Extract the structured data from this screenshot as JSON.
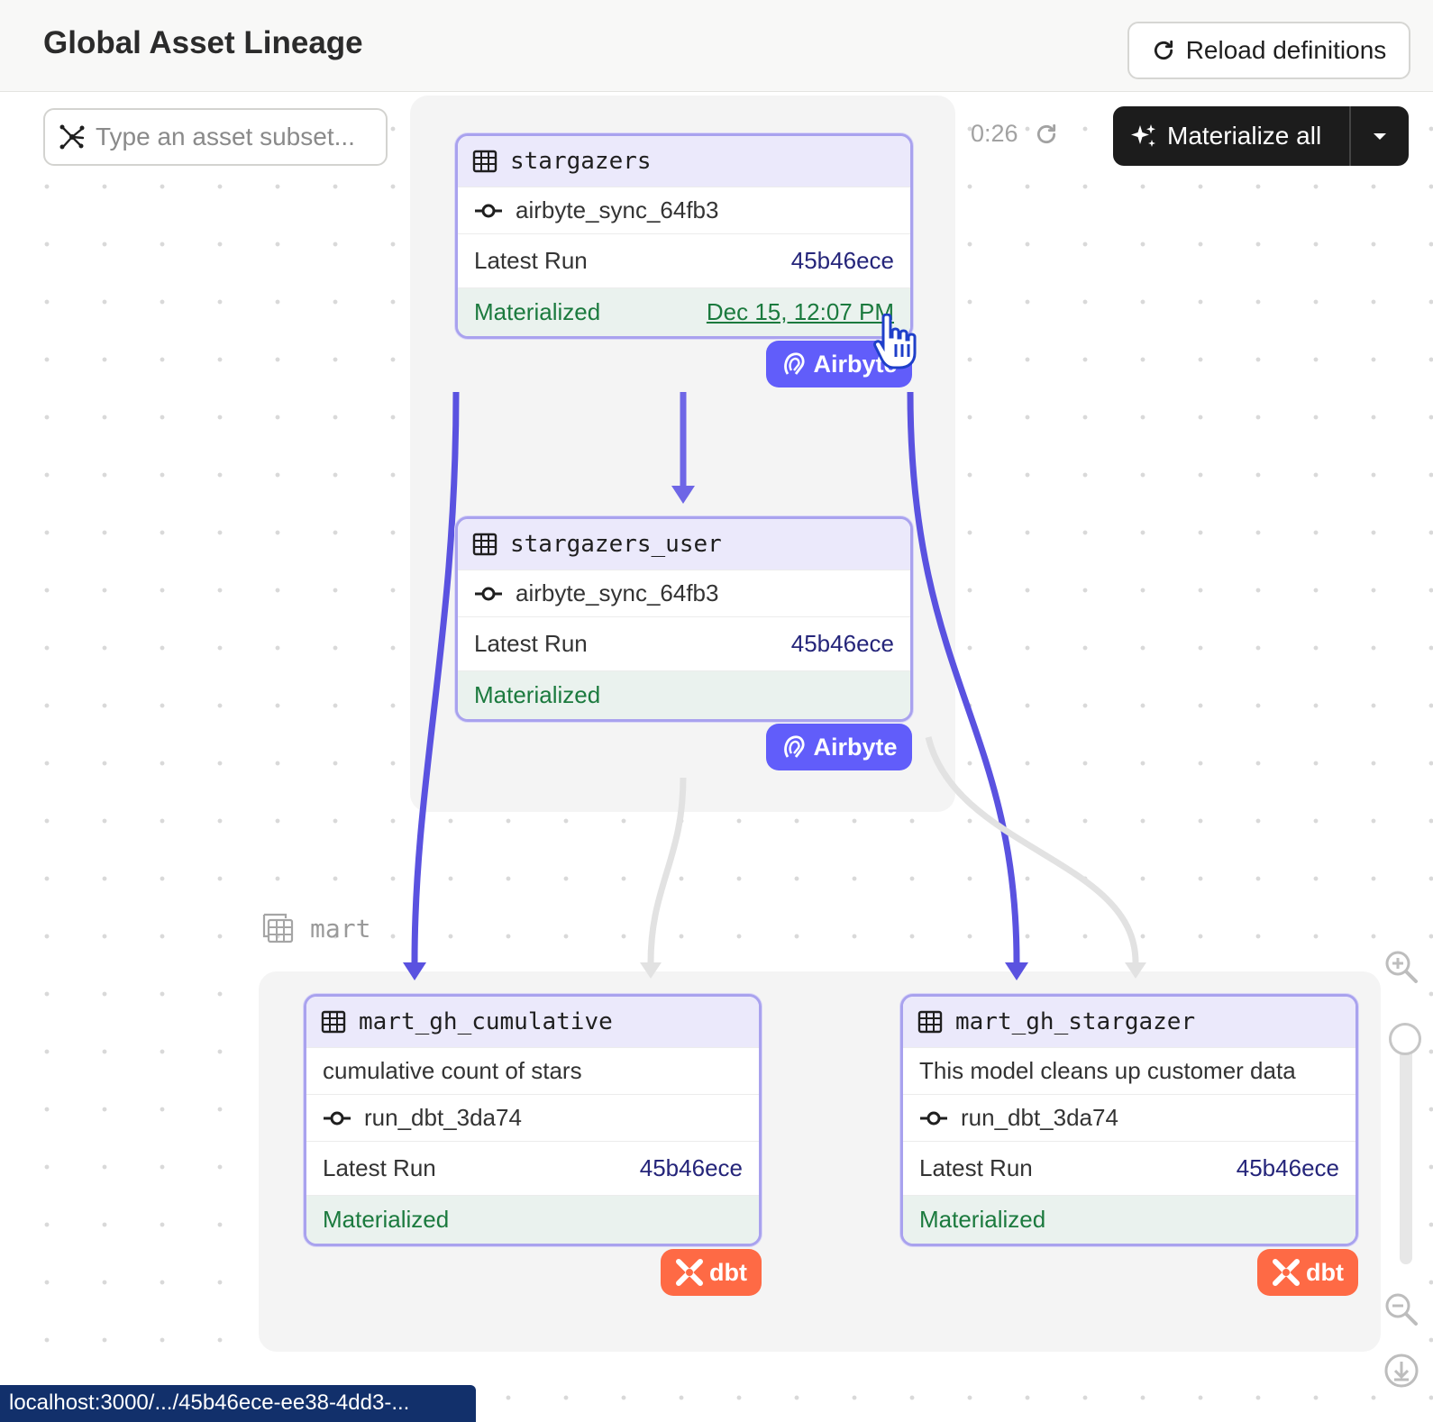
{
  "header": {
    "title": "Global Asset Lineage",
    "reload_label": "Reload definitions"
  },
  "toolbar": {
    "search_placeholder": "Type an asset subset...",
    "timer": "0:26",
    "materialize_label": "Materialize all"
  },
  "group_label": "mart",
  "nodes": [
    {
      "name": "stargazers",
      "op": "airbyte_sync_64fb3",
      "latest_run_label": "Latest Run",
      "latest_run": "45b46ece",
      "status": "Materialized",
      "materialized_at": "Dec 15, 12:07 PM",
      "kind": "Airbyte"
    },
    {
      "name": "stargazers_user",
      "op": "airbyte_sync_64fb3",
      "latest_run_label": "Latest Run",
      "latest_run": "45b46ece",
      "status": "Materialized",
      "materialized_at": "",
      "kind": "Airbyte"
    },
    {
      "name": "mart_gh_cumulative",
      "description": "cumulative count of stars",
      "op": "run_dbt_3da74",
      "latest_run_label": "Latest Run",
      "latest_run": "45b46ece",
      "status": "Materialized",
      "kind": "dbt"
    },
    {
      "name": "mart_gh_stargazer",
      "description": "This model cleans up customer data",
      "op": "run_dbt_3da74",
      "latest_run_label": "Latest Run",
      "latest_run": "45b46ece",
      "status": "Materialized",
      "kind": "dbt"
    }
  ],
  "status_url": "localhost:3000/.../45b46ece-ee38-4dd3-...",
  "colors": {
    "accent": "#615dfa",
    "edge_active": "#5a52e0",
    "edge_inactive": "#e2e2e2",
    "dbt": "#fe6a45",
    "materialized": "#1b7a3e"
  }
}
